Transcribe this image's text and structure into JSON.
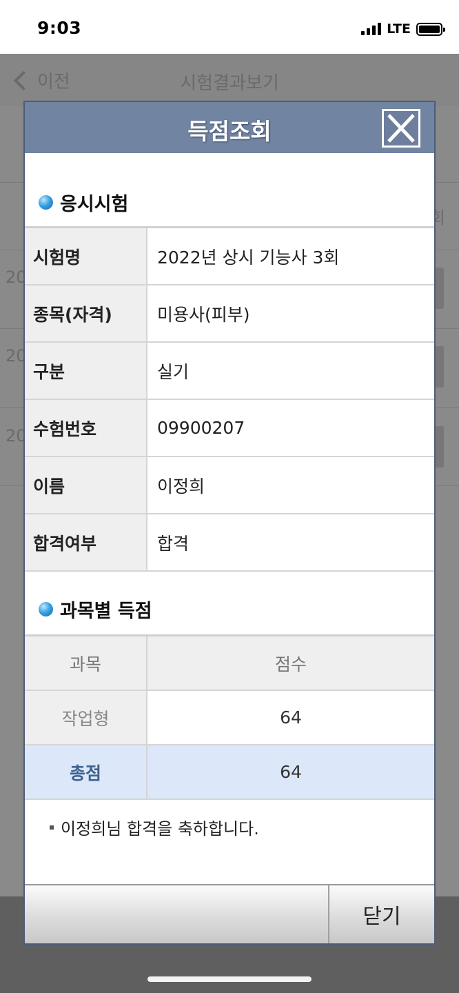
{
  "status_bar": {
    "time": "9:03",
    "network": "LTE"
  },
  "background": {
    "back_label": "이전",
    "title": "시험결과보기",
    "row_fragments": [
      "20",
      "20",
      "20"
    ],
    "side_char": "회"
  },
  "dialog": {
    "title": "득점조회",
    "section_exam": "응시시험",
    "exam_info": [
      {
        "label": "시험명",
        "value": "2022년 상시 기능사 3회"
      },
      {
        "label": "종목(자격)",
        "value": "미용사(피부)"
      },
      {
        "label": "구분",
        "value": "실기"
      },
      {
        "label": "수험번호",
        "value": "09900207"
      },
      {
        "label": "이름",
        "value": "이정희"
      },
      {
        "label": "합격여부",
        "value": "합격"
      }
    ],
    "section_scores": "과목별 득점",
    "score_table": {
      "headers": [
        "과목",
        "점수"
      ],
      "rows": [
        {
          "subject": "작업형",
          "score": "64"
        }
      ],
      "total": {
        "label": "총점",
        "score": "64"
      }
    },
    "message": "이정희님 합격을 축하합니다.",
    "close_button": "닫기"
  },
  "colors": {
    "dialog_header": "#7184a2",
    "total_row": "#dce8f9",
    "total_label": "#3d6190",
    "bullet": "#39a1e3"
  }
}
